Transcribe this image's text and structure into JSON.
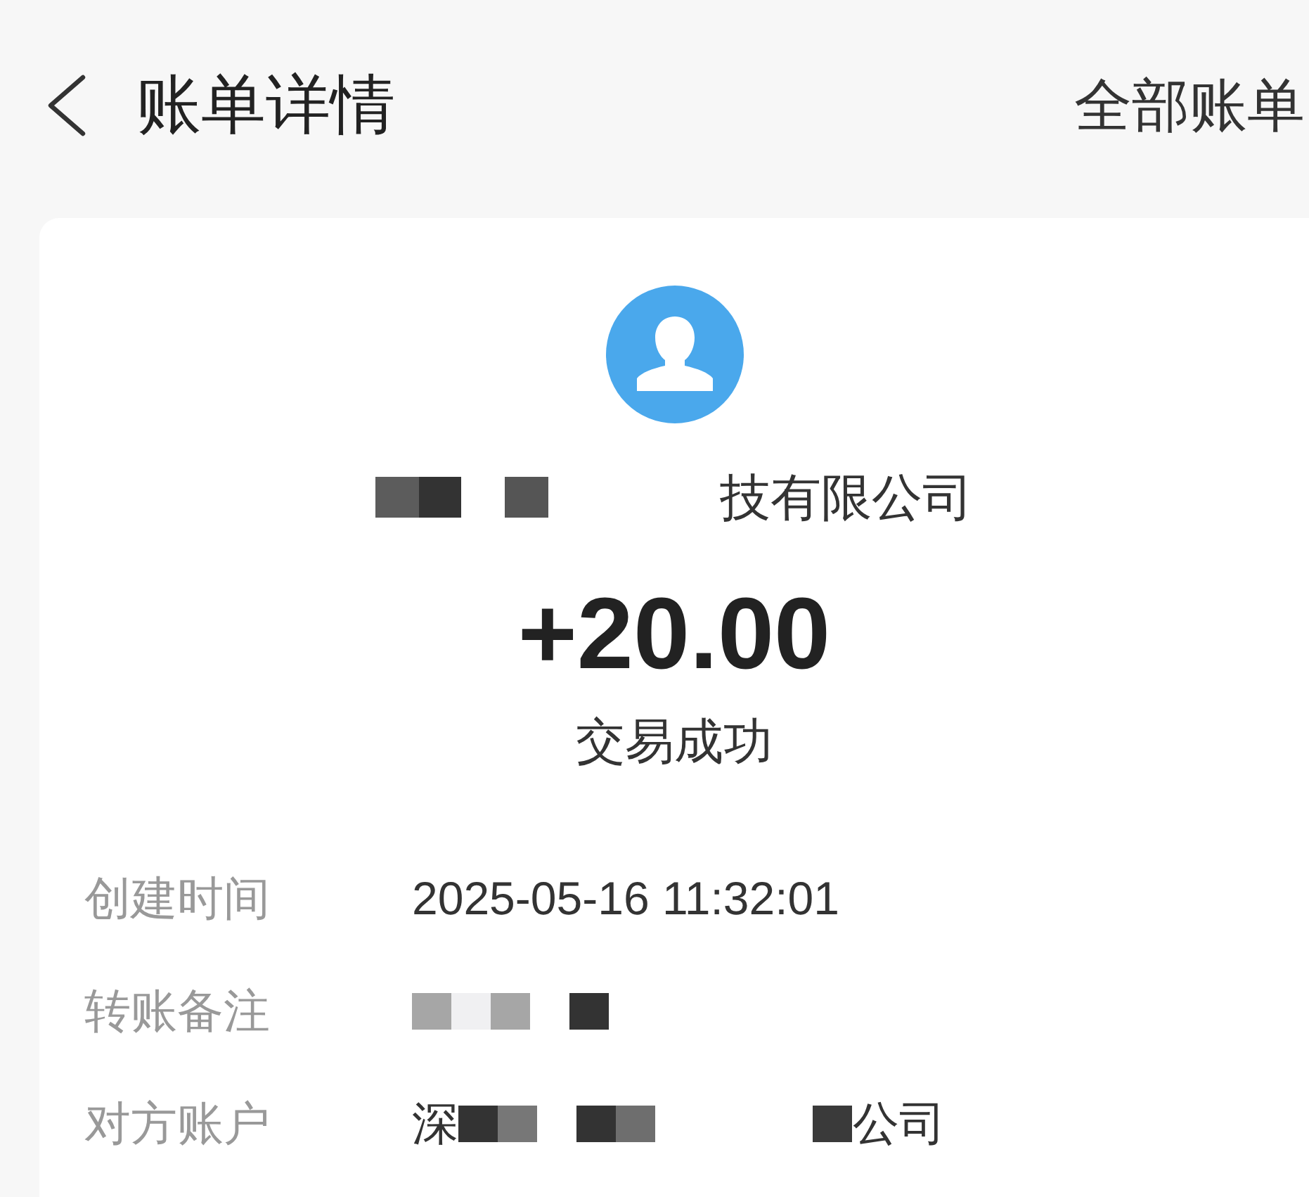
{
  "header": {
    "title": "账单详情",
    "action": "全部账单"
  },
  "payee": {
    "name_parts": [
      {
        "kind": "redacted",
        "color": "#5c5c5c"
      },
      {
        "kind": "redacted",
        "color": "#333333"
      },
      {
        "kind": "gap"
      },
      {
        "kind": "redacted",
        "color": "#555555"
      },
      {
        "kind": "gap"
      },
      {
        "kind": "gap"
      },
      {
        "kind": "gap"
      },
      {
        "kind": "gap"
      },
      {
        "kind": "text",
        "text": "技有限公司"
      }
    ]
  },
  "amount": "+20.00",
  "status": "交易成功",
  "details": [
    {
      "label": "创建时间",
      "value_parts": [
        {
          "kind": "text",
          "text": "2025-05-16 11:32:01"
        }
      ]
    },
    {
      "label": "转账备注",
      "value_parts": [
        {
          "kind": "redacted",
          "color": "#a6a6a6"
        },
        {
          "kind": "redacted",
          "color": "#f0f0f2"
        },
        {
          "kind": "redacted",
          "color": "#a6a6a6"
        },
        {
          "kind": "gap"
        },
        {
          "kind": "redacted",
          "color": "#333333"
        }
      ]
    },
    {
      "label": "对方账户",
      "value_parts": [
        {
          "kind": "text",
          "text": "深"
        },
        {
          "kind": "redacted",
          "color": "#333333"
        },
        {
          "kind": "redacted",
          "color": "#777777"
        },
        {
          "kind": "gap"
        },
        {
          "kind": "redacted",
          "color": "#333333"
        },
        {
          "kind": "redacted",
          "color": "#6e6e6e"
        },
        {
          "kind": "gap"
        },
        {
          "kind": "gap"
        },
        {
          "kind": "gap"
        },
        {
          "kind": "gap"
        },
        {
          "kind": "redacted",
          "color": "#3a3a3a"
        },
        {
          "kind": "text",
          "text": "公司"
        }
      ]
    }
  ]
}
